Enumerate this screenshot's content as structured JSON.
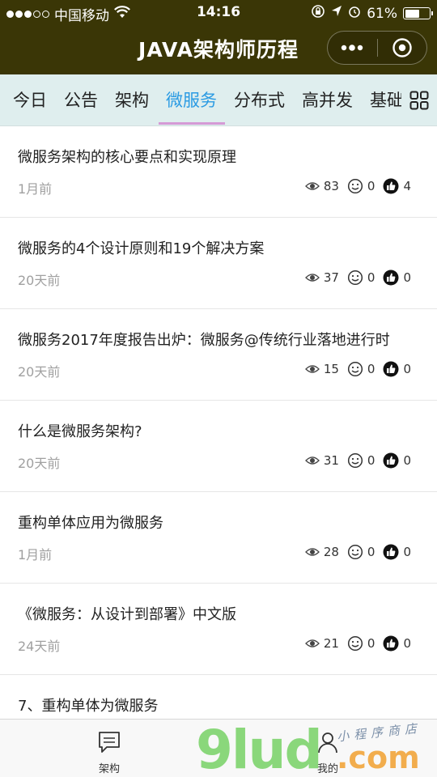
{
  "status_bar": {
    "carrier": "中国移动",
    "time": "14:16",
    "battery_percent": "61%",
    "battery_level": 0.61,
    "signal_dots_filled": 3,
    "signal_dots_total": 5
  },
  "nav": {
    "title": "JAVA架构师历程"
  },
  "tabs": [
    {
      "label": "今日"
    },
    {
      "label": "公告"
    },
    {
      "label": "架构"
    },
    {
      "label": "微服务",
      "active": true
    },
    {
      "label": "分布式"
    },
    {
      "label": "高并发"
    },
    {
      "label": "基础"
    }
  ],
  "articles": [
    {
      "title": "微服务架构的核心要点和实现原理",
      "time": "1月前",
      "views": "83",
      "comments": "0",
      "likes": "4"
    },
    {
      "title": "微服务的4个设计原则和19个解决方案",
      "time": "20天前",
      "views": "37",
      "comments": "0",
      "likes": "0"
    },
    {
      "title": "微服务2017年度报告出炉：微服务@传统行业落地进行时",
      "time": "20天前",
      "views": "15",
      "comments": "0",
      "likes": "0"
    },
    {
      "title": "什么是微服务架构?",
      "time": "20天前",
      "views": "31",
      "comments": "0",
      "likes": "0"
    },
    {
      "title": "重构单体应用为微服务",
      "time": "1月前",
      "views": "28",
      "comments": "0",
      "likes": "0"
    },
    {
      "title": "《微服务：从设计到部署》中文版",
      "time": "24天前",
      "views": "21",
      "comments": "0",
      "likes": "0"
    },
    {
      "title": "7、重构单体为微服务",
      "time": "",
      "views": "",
      "comments": "",
      "likes": ""
    }
  ],
  "tabbar": {
    "items": [
      {
        "label": "架构",
        "icon": "message-icon"
      },
      {
        "label": "我的",
        "icon": "user-icon"
      }
    ]
  },
  "watermark": {
    "brand": "9lud",
    "suffix": ".com",
    "tagline": "小程序商店"
  },
  "colors": {
    "topbar": "#3a3606",
    "tabs_bg": "#dfeeee",
    "active_tab": "#2b9be3",
    "active_underline": "#d59ad6"
  }
}
